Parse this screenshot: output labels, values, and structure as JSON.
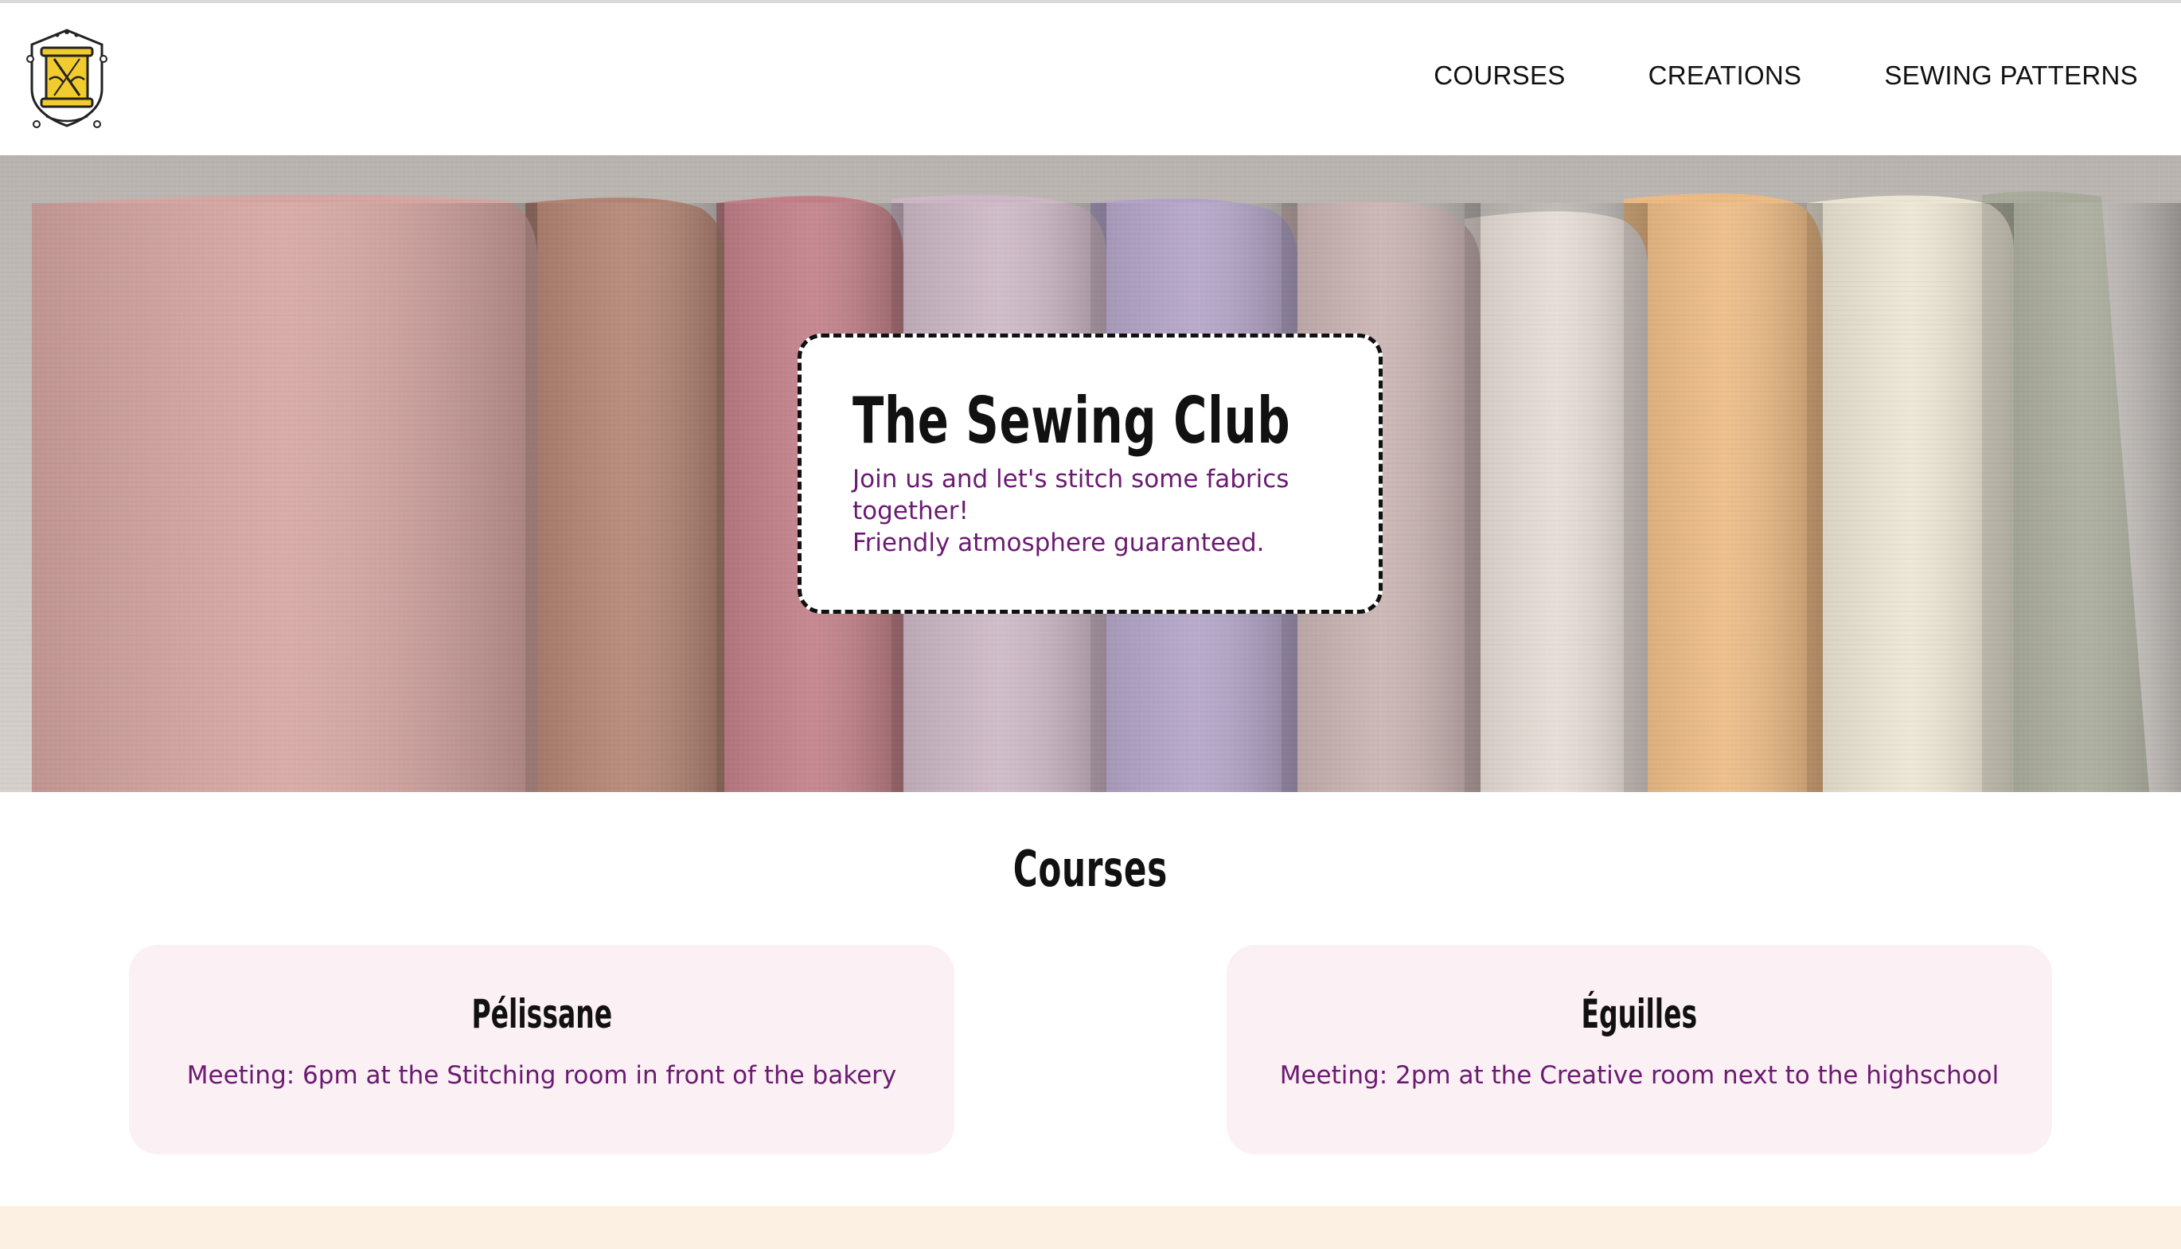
{
  "header": {
    "logo_icon": "sewing-spool-crest-logo",
    "nav": [
      {
        "label": "COURSES"
      },
      {
        "label": "CREATIONS"
      },
      {
        "label": "SEWING PATTERNS"
      }
    ]
  },
  "hero": {
    "image": "folded-linen-fabrics",
    "title": "The Sewing Club",
    "line1": "Join us and let's stitch some fabrics together!",
    "line2": "Friendly atmosphere guaranteed."
  },
  "courses": {
    "title": "Courses",
    "items": [
      {
        "name": "Pélissane",
        "meeting": "Meeting: 6pm at the Stitching room in front of the bakery"
      },
      {
        "name": "Éguilles",
        "meeting": "Meeting: 2pm at the Creative room next to the highschool"
      }
    ]
  },
  "colors": {
    "accent_text": "#6b1a72",
    "card_bg": "#fbf0f4",
    "footer_bg": "#fcf0e2"
  }
}
